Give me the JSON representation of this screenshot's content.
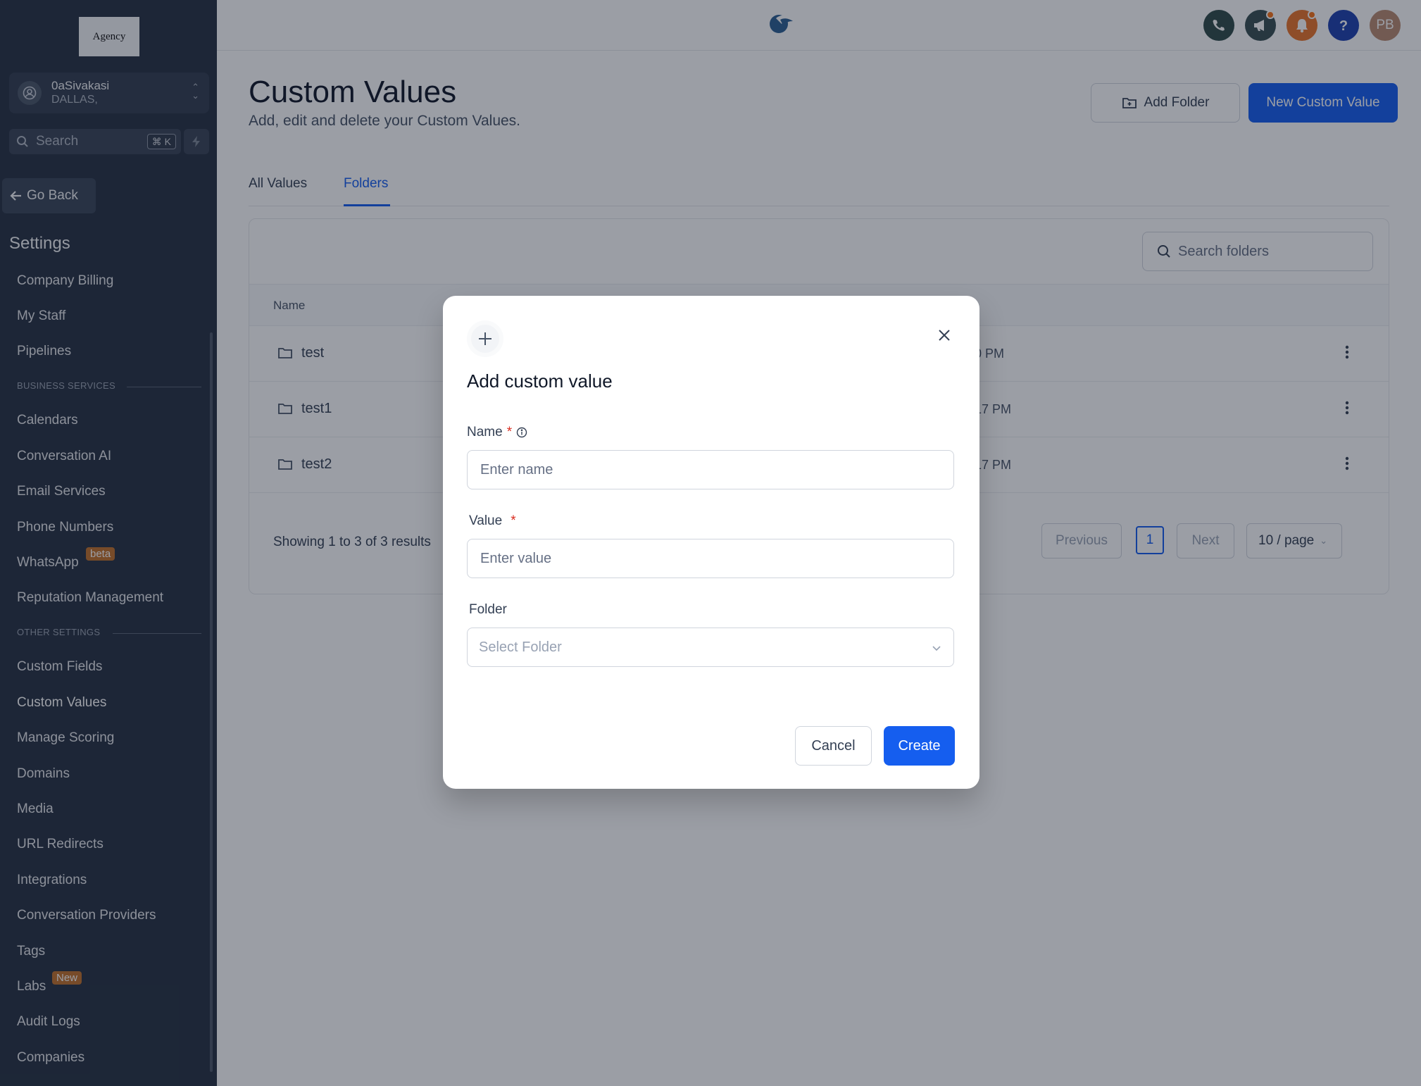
{
  "sidebar": {
    "logo_text": "Agency",
    "account": {
      "name": "0aSivakasi",
      "location": "DALLAS,"
    },
    "search": {
      "placeholder": "Search",
      "shortcut": "⌘ K"
    },
    "go_back": "Go Back",
    "settings_title": "Settings",
    "items_top": [
      "Company Billing",
      "My Staff",
      "Pipelines"
    ],
    "section_business": "BUSINESS SERVICES",
    "items_business": [
      "Calendars",
      "Conversation AI",
      "Email Services",
      "Phone Numbers",
      "WhatsApp",
      "Reputation Management"
    ],
    "whatsapp_badge": "beta",
    "section_other": "OTHER SETTINGS",
    "items_other": [
      "Custom Fields",
      "Custom Values",
      "Manage Scoring",
      "Domains",
      "Media",
      "URL Redirects",
      "Integrations",
      "Conversation Providers",
      "Tags",
      "Labs",
      "Audit Logs",
      "Companies"
    ],
    "labs_badge": "New",
    "active_item": "Custom Values"
  },
  "topbar": {
    "avatar_initials": "PB",
    "icons": [
      "phone-icon",
      "megaphone-icon",
      "bell-icon",
      "help-icon"
    ],
    "colors": {
      "phone": "#2f4b49",
      "megaphone": "#374f52",
      "bell": "#e8742a",
      "help": "#1e40af",
      "avatar": "#b98a70"
    }
  },
  "page": {
    "title": "Custom Values",
    "subtitle": "Add, edit and delete your Custom Values.",
    "add_folder_label": "Add Folder",
    "new_custom_value_label": "New Custom Value",
    "tabs": [
      {
        "label": "All Values",
        "active": false
      },
      {
        "label": "Folders",
        "active": true
      }
    ],
    "search_folders_placeholder": "Search folders",
    "table": {
      "column_name": "Name",
      "rows": [
        {
          "name": "test",
          "date_fragment": "0 PM"
        },
        {
          "name": "test1",
          "date_fragment": "17 PM"
        },
        {
          "name": "test2",
          "date_fragment": "17 PM"
        }
      ]
    },
    "pagination": {
      "showing": "Showing 1 to 3 of 3 results",
      "previous": "Previous",
      "current_page": "1",
      "next": "Next",
      "per_page": "10 / page"
    }
  },
  "modal": {
    "title": "Add custom value",
    "name_label": "Name",
    "name_required": "*",
    "name_placeholder": "Enter name",
    "value_label": "Value",
    "value_required": "*",
    "value_placeholder": "Enter value",
    "folder_label": "Folder",
    "folder_placeholder": "Select Folder",
    "cancel_label": "Cancel",
    "create_label": "Create"
  },
  "colors": {
    "primary": "#155eef",
    "sidebar_bg": "#273142",
    "badge": "#c2702a"
  }
}
